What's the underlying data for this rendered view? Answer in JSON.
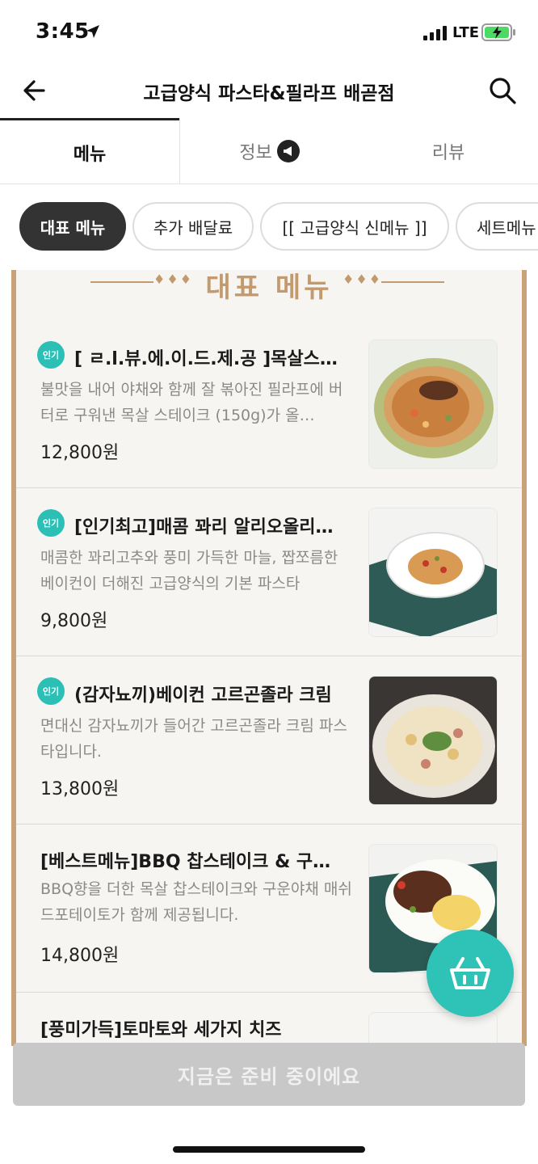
{
  "status_bar": {
    "time": "3:45",
    "network": "LTE"
  },
  "header": {
    "title": "고급양식 파스타&필라프 배곧점"
  },
  "tabs": [
    {
      "label": "메뉴"
    },
    {
      "label": "정보"
    },
    {
      "label": "리뷰"
    }
  ],
  "categories": [
    {
      "label": "대표 메뉴"
    },
    {
      "label": "추가 배달료"
    },
    {
      "label": "[[ 고급양식 신메뉴 ]]"
    },
    {
      "label": "세트메뉴"
    }
  ],
  "board": {
    "title": "대표 메뉴"
  },
  "badge_label": "인기",
  "menu_items": [
    {
      "name": "[ ㄹ.l.뷰.에.이.드.제.공 ]목살스…",
      "description": "불맛을 내어 야채와 함께 잘 볶아진 필라프에 버터로 구워낸 목살 스테이크 (150g)가 올…",
      "price": "12,800원"
    },
    {
      "name": "[인기최고]매콤 꽈리 알리오올리…",
      "description": "매콤한 꽈리고추와 풍미 가득한 마늘, 짭쪼름한 베이컨이 더해진 고급양식의 기본 파스타",
      "price": "9,800원"
    },
    {
      "name": "(감자뇨끼)베이컨 고르곤졸라 크림",
      "description": "면대신 감자뇨끼가 들어간 고르곤졸라 크림 파스타입니다.",
      "price": "13,800원"
    },
    {
      "name": "[베스트메뉴]BBQ 찹스테이크 & 구…",
      "description": "BBQ향을 더한 목살 찹스테이크와 구운야채 매쉬드포테이토가 함께 제공됩니다.",
      "price": "14,800원"
    },
    {
      "name": "[풍미가득]토마토와 세가지 치즈",
      "description": "",
      "price": ""
    }
  ],
  "footer": {
    "button_label": "지금은 준비 중이에요"
  },
  "colors": {
    "accent": "#2fc2b6",
    "board_border": "#c8a37a",
    "title_gold": "#c39a6d"
  }
}
